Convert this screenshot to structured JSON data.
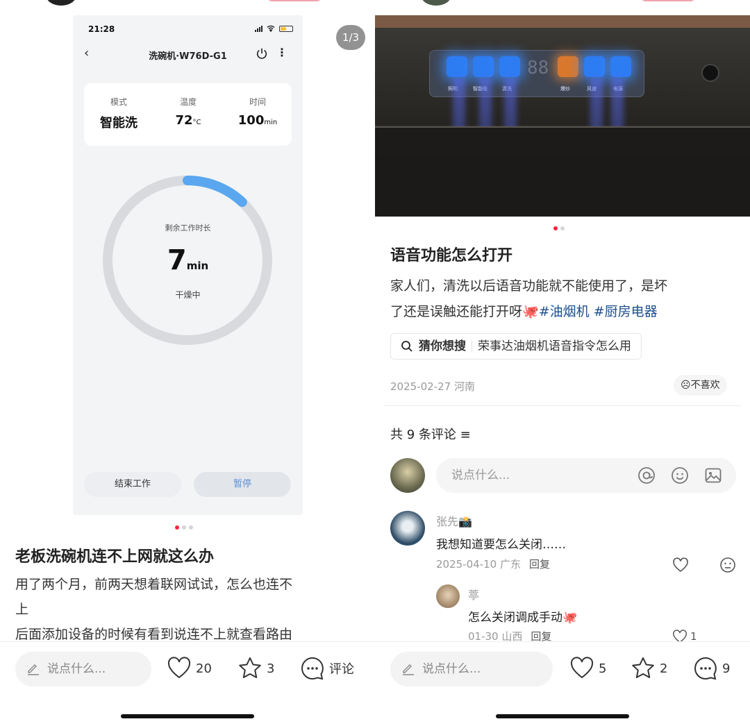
{
  "left": {
    "page_indicator": "1/3",
    "screenshot": {
      "time": "21:28",
      "title": "洗碗机·W76D-G1",
      "info": [
        {
          "key": "模式",
          "value": "智能洗",
          "unit": ""
        },
        {
          "key": "温度",
          "value": "72",
          "unit": "°C"
        },
        {
          "key": "时间",
          "value": "100",
          "unit": "min"
        }
      ],
      "ring_label": "剩余工作时长",
      "ring_value": "7",
      "ring_unit": "min",
      "ring_status": "干燥中",
      "ring_progress": 0.12,
      "end_button": "结束工作",
      "pause_button": "暂停"
    },
    "post_title": "老板洗碗机连不上网就这么办",
    "post_body_1": "用了两个月，前两天想着联网试试，怎么也连不",
    "post_body_2": "上",
    "post_body_3": "后面添加设备的时候有看到说连不上就查看路由",
    "say_placeholder": "说点什么...",
    "likes": "20",
    "stars": "3",
    "comment_label": "评论"
  },
  "right": {
    "panel_labels": [
      "照明",
      "智能吸",
      "清洗",
      "爆炒",
      "风速",
      "电源"
    ],
    "panel_sublabels": [
      "Light",
      "Inhale",
      "Cleaning",
      "Panfried",
      "Speed",
      "ON/OFF"
    ],
    "panel_display": "88",
    "title": "语音功能怎么打开",
    "body_line1": "家人们，清洗以后语音功能就不能使用了，是坏",
    "body_line2_start": "了还是误触还能打开呀",
    "body_emoji": "🐙",
    "tag1": "#油烟机",
    "tag2": "#厨房电器",
    "guess_label": "猜你想搜",
    "guess_query": "荣事达油烟机语音指令怎么用",
    "date_location": "2025-02-27 河南",
    "dislike_label": "不喜欢",
    "comment_count": "共 9 条评论",
    "input_placeholder": "说点什么...",
    "comments": [
      {
        "name": "张先",
        "badge": "📸",
        "text": "我想知道要怎么关闭……",
        "date": "2025-04-10 广东",
        "reply": "回复",
        "likes": ""
      },
      {
        "name": "葶",
        "badge": "",
        "text": "怎么关闭调成手动🐙",
        "date": "01-30 山西",
        "reply": "回复",
        "likes": "1"
      }
    ],
    "say_placeholder": "说点什么...",
    "likes": "5",
    "stars": "2",
    "comments_total": "9"
  },
  "colors": {
    "accent": "#ff2442",
    "ring_progress": "#5aa7f0",
    "ring_track": "#d9dadd",
    "tag": "#1c4f8c"
  }
}
